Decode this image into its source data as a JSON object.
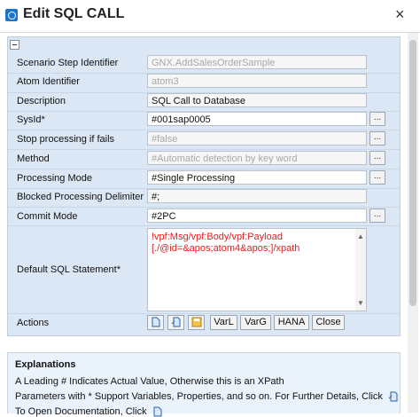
{
  "window": {
    "title": "Edit SQL CALL",
    "close_label": "×"
  },
  "form": {
    "rows": [
      {
        "label": "Scenario Step Identifier",
        "value": "GNX.AddSalesOrderSample"
      },
      {
        "label": "Atom Identifier",
        "value": "atom3"
      },
      {
        "label": "Description",
        "value": "SQL Call to Database"
      },
      {
        "label": "SysId*",
        "value": "#001sap0005",
        "button": "..."
      },
      {
        "label": "Stop processing if fails",
        "value": "#false",
        "button": "..."
      },
      {
        "label": "Method",
        "value": "#Automatic detection by key word",
        "button": "..."
      },
      {
        "label": "Processing Mode",
        "value": "#Single Processing",
        "button": "..."
      },
      {
        "label": "Blocked Processing Delimiter",
        "value": "#;"
      },
      {
        "label": "Commit Mode",
        "value": "#2PC",
        "button": "..."
      }
    ],
    "sql": {
      "label": "Default SQL Statement*",
      "line1": "!vpf:Msg/vpf:Body/vpf:Payload",
      "line2": "[./@id=&apos;atom4&apos;]/xpath"
    },
    "actions": {
      "label": "Actions",
      "buttons": [
        "VarL",
        "VarG",
        "HANA",
        "Close"
      ]
    }
  },
  "explanations": {
    "title": "Explanations",
    "line1": "A Leading # Indicates Actual Value, Otherwise this is an XPath",
    "line2": "Parameters with * Support Variables, Properties, and so on. For Further Details, Click",
    "line3": "To Open Documentation, Click"
  }
}
